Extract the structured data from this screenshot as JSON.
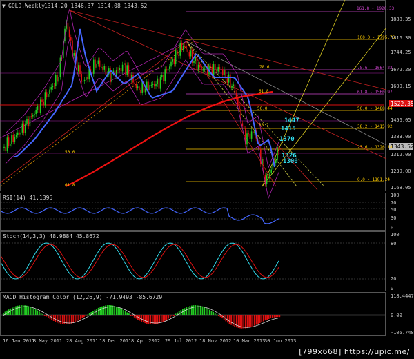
{
  "header": {
    "symbol": "GOLD,Weekly",
    "ohlc": "1314.20 1346.37 1314.08 1343.52"
  },
  "price_scale": {
    "labels": [
      "1888.35",
      "1816.30",
      "1744.25",
      "1672.20",
      "1600.15",
      "1528.10",
      "1456.05",
      "1383.00",
      "1312.00",
      "1239.00",
      "1168.05"
    ],
    "current_price": "1343.52",
    "marked_price": "1522.35"
  },
  "fib_lines": [
    {
      "text": "100.0 - 1795.75"
    },
    {
      "text": "78.6 - 1664.22"
    },
    {
      "text": "61.8 - 1560.97"
    },
    {
      "text": "50.0 - 1488.44"
    },
    {
      "text": "38.2 - 1415.92"
    },
    {
      "text": "23.6 - 1326.18"
    },
    {
      "text": "0.0 - 1181.24"
    }
  ],
  "top_fib_label": "161.8 - 1920.33",
  "chart_annotations": [
    "78.6",
    "61.8",
    "50.0",
    "38.2",
    "50.0",
    "61.8"
  ],
  "price_targets": [
    "1447",
    "1415",
    "1370",
    "1326",
    "1300"
  ],
  "rsi": {
    "title": "RSI(14) 41.1396",
    "levels": [
      "100",
      "70",
      "50",
      "30",
      "0"
    ]
  },
  "stoch": {
    "title": "Stoch(14,3,3) 48.9884 45.8672",
    "levels": [
      "100",
      "80",
      "20",
      "0"
    ]
  },
  "macd": {
    "title": "MACD_Histogram_Color (12,26,9) -71.9493 -85.6729",
    "levels": [
      "118.4447",
      "0.00",
      "-105.7484"
    ]
  },
  "time_axis": [
    "16 Jan 2011",
    "8 May 2011",
    "28 Aug 2011",
    "18 Dec 2011",
    "8 Apr 2012",
    "29 Jul 2012",
    "18 Nov 2012",
    "10 Mar 2013",
    "30 Jun 2013"
  ],
  "watermark": "[799x668] https://upic.me/",
  "colors": {
    "background": "#000000",
    "bull": "#22cc22",
    "bear": "#dd1111",
    "ma_fast": "#4466ff",
    "ma_slow": "#ee1111",
    "bollinger": "#aa22aa",
    "fib": "#ffcc00",
    "target": "#33ddee"
  }
}
